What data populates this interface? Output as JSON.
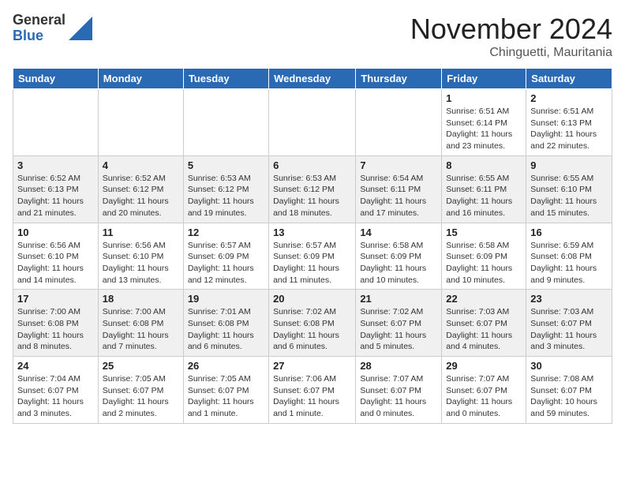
{
  "logo": {
    "general": "General",
    "blue": "Blue"
  },
  "header": {
    "month": "November 2024",
    "location": "Chinguetti, Mauritania"
  },
  "weekdays": [
    "Sunday",
    "Monday",
    "Tuesday",
    "Wednesday",
    "Thursday",
    "Friday",
    "Saturday"
  ],
  "weeks": [
    [
      {
        "day": "",
        "info": ""
      },
      {
        "day": "",
        "info": ""
      },
      {
        "day": "",
        "info": ""
      },
      {
        "day": "",
        "info": ""
      },
      {
        "day": "",
        "info": ""
      },
      {
        "day": "1",
        "info": "Sunrise: 6:51 AM\nSunset: 6:14 PM\nDaylight: 11 hours\nand 23 minutes."
      },
      {
        "day": "2",
        "info": "Sunrise: 6:51 AM\nSunset: 6:13 PM\nDaylight: 11 hours\nand 22 minutes."
      }
    ],
    [
      {
        "day": "3",
        "info": "Sunrise: 6:52 AM\nSunset: 6:13 PM\nDaylight: 11 hours\nand 21 minutes."
      },
      {
        "day": "4",
        "info": "Sunrise: 6:52 AM\nSunset: 6:12 PM\nDaylight: 11 hours\nand 20 minutes."
      },
      {
        "day": "5",
        "info": "Sunrise: 6:53 AM\nSunset: 6:12 PM\nDaylight: 11 hours\nand 19 minutes."
      },
      {
        "day": "6",
        "info": "Sunrise: 6:53 AM\nSunset: 6:12 PM\nDaylight: 11 hours\nand 18 minutes."
      },
      {
        "day": "7",
        "info": "Sunrise: 6:54 AM\nSunset: 6:11 PM\nDaylight: 11 hours\nand 17 minutes."
      },
      {
        "day": "8",
        "info": "Sunrise: 6:55 AM\nSunset: 6:11 PM\nDaylight: 11 hours\nand 16 minutes."
      },
      {
        "day": "9",
        "info": "Sunrise: 6:55 AM\nSunset: 6:10 PM\nDaylight: 11 hours\nand 15 minutes."
      }
    ],
    [
      {
        "day": "10",
        "info": "Sunrise: 6:56 AM\nSunset: 6:10 PM\nDaylight: 11 hours\nand 14 minutes."
      },
      {
        "day": "11",
        "info": "Sunrise: 6:56 AM\nSunset: 6:10 PM\nDaylight: 11 hours\nand 13 minutes."
      },
      {
        "day": "12",
        "info": "Sunrise: 6:57 AM\nSunset: 6:09 PM\nDaylight: 11 hours\nand 12 minutes."
      },
      {
        "day": "13",
        "info": "Sunrise: 6:57 AM\nSunset: 6:09 PM\nDaylight: 11 hours\nand 11 minutes."
      },
      {
        "day": "14",
        "info": "Sunrise: 6:58 AM\nSunset: 6:09 PM\nDaylight: 11 hours\nand 10 minutes."
      },
      {
        "day": "15",
        "info": "Sunrise: 6:58 AM\nSunset: 6:09 PM\nDaylight: 11 hours\nand 10 minutes."
      },
      {
        "day": "16",
        "info": "Sunrise: 6:59 AM\nSunset: 6:08 PM\nDaylight: 11 hours\nand 9 minutes."
      }
    ],
    [
      {
        "day": "17",
        "info": "Sunrise: 7:00 AM\nSunset: 6:08 PM\nDaylight: 11 hours\nand 8 minutes."
      },
      {
        "day": "18",
        "info": "Sunrise: 7:00 AM\nSunset: 6:08 PM\nDaylight: 11 hours\nand 7 minutes."
      },
      {
        "day": "19",
        "info": "Sunrise: 7:01 AM\nSunset: 6:08 PM\nDaylight: 11 hours\nand 6 minutes."
      },
      {
        "day": "20",
        "info": "Sunrise: 7:02 AM\nSunset: 6:08 PM\nDaylight: 11 hours\nand 6 minutes."
      },
      {
        "day": "21",
        "info": "Sunrise: 7:02 AM\nSunset: 6:07 PM\nDaylight: 11 hours\nand 5 minutes."
      },
      {
        "day": "22",
        "info": "Sunrise: 7:03 AM\nSunset: 6:07 PM\nDaylight: 11 hours\nand 4 minutes."
      },
      {
        "day": "23",
        "info": "Sunrise: 7:03 AM\nSunset: 6:07 PM\nDaylight: 11 hours\nand 3 minutes."
      }
    ],
    [
      {
        "day": "24",
        "info": "Sunrise: 7:04 AM\nSunset: 6:07 PM\nDaylight: 11 hours\nand 3 minutes."
      },
      {
        "day": "25",
        "info": "Sunrise: 7:05 AM\nSunset: 6:07 PM\nDaylight: 11 hours\nand 2 minutes."
      },
      {
        "day": "26",
        "info": "Sunrise: 7:05 AM\nSunset: 6:07 PM\nDaylight: 11 hours\nand 1 minute."
      },
      {
        "day": "27",
        "info": "Sunrise: 7:06 AM\nSunset: 6:07 PM\nDaylight: 11 hours\nand 1 minute."
      },
      {
        "day": "28",
        "info": "Sunrise: 7:07 AM\nSunset: 6:07 PM\nDaylight: 11 hours\nand 0 minutes."
      },
      {
        "day": "29",
        "info": "Sunrise: 7:07 AM\nSunset: 6:07 PM\nDaylight: 11 hours\nand 0 minutes."
      },
      {
        "day": "30",
        "info": "Sunrise: 7:08 AM\nSunset: 6:07 PM\nDaylight: 10 hours\nand 59 minutes."
      }
    ]
  ]
}
